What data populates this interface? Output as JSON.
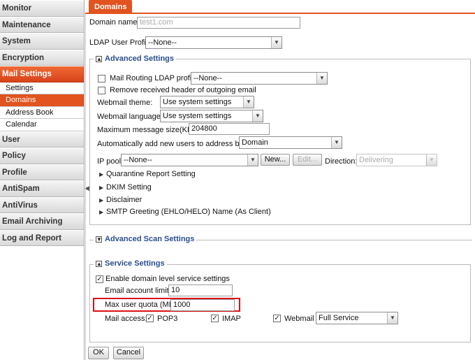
{
  "sidebar": {
    "groups_before": [
      {
        "label": "Monitor"
      },
      {
        "label": "Maintenance"
      },
      {
        "label": "System"
      },
      {
        "label": "Encryption"
      }
    ],
    "active_group": {
      "label": "Mail Settings"
    },
    "sub_items": [
      {
        "label": "Settings"
      },
      {
        "label": "Domains"
      },
      {
        "label": "Address Book"
      },
      {
        "label": "Calendar"
      }
    ],
    "groups_after": [
      {
        "label": "User"
      },
      {
        "label": "Policy"
      },
      {
        "label": "Profile"
      },
      {
        "label": "AntiSpam"
      },
      {
        "label": "AntiVirus"
      },
      {
        "label": "Email Archiving"
      },
      {
        "label": "Log and Report"
      }
    ]
  },
  "tab": {
    "label": "Domains"
  },
  "form": {
    "domain_name_label": "Domain name:",
    "domain_name_value": "test1.com",
    "ldap_profile_label": "LDAP User Profile",
    "ldap_profile_value": "--None--"
  },
  "advanced": {
    "legend": "Advanced Settings",
    "toggle": "▲",
    "mail_routing_label": "Mail Routing LDAP profile:",
    "mail_routing_value": "--None--",
    "remove_header_label": "Remove received header of outgoing email",
    "webmail_theme_label": "Webmail theme:",
    "webmail_theme_value": "Use system settings",
    "webmail_language_label": "Webmail language:",
    "webmail_language_value": "Use system settings",
    "max_msg_label": "Maximum message size(KB):",
    "max_msg_value": "204800",
    "auto_add_label": "Automatically add new users to address book:",
    "auto_add_value": "Domain",
    "ip_pool_label": "IP pool:",
    "ip_pool_value": "--None--",
    "new_button": "New...",
    "edit_button": "Edit...",
    "direction_label": "Direction:",
    "direction_value": "Delivering",
    "collapsed_sections": [
      {
        "label": "Quarantine Report Setting"
      },
      {
        "label": "DKIM Setting"
      },
      {
        "label": "Disclaimer"
      },
      {
        "label": "SMTP Greeting (EHLO/HELO) Name (As Client)"
      }
    ]
  },
  "advanced_scan": {
    "legend": "Advanced Scan Settings",
    "toggle": "▼"
  },
  "service": {
    "legend": "Service Settings",
    "toggle": "▲",
    "enable_label": "Enable domain level service settings",
    "account_limit_label": "Email account limit:",
    "account_limit_value": "10",
    "max_quota_label": "Max user quota (MB):",
    "max_quota_value": "1000",
    "mail_access_label": "Mail access:",
    "pop3_label": "POP3",
    "imap_label": "IMAP",
    "webmail_label": "Webmail",
    "webmail_mode_value": "Full Service"
  },
  "buttons": {
    "ok": "OK",
    "cancel": "Cancel"
  },
  "icons": {
    "check": "✓",
    "arrow": "▼",
    "triangle": "▶"
  }
}
